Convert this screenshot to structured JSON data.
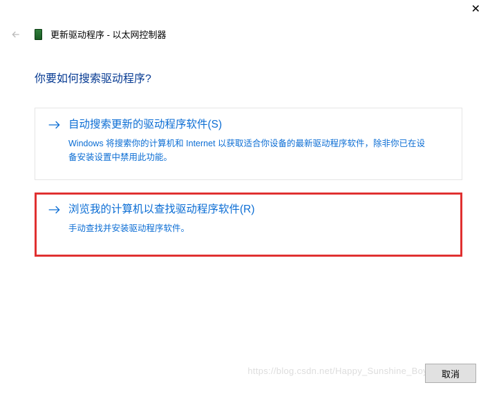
{
  "window": {
    "title": "更新驱动程序 - 以太网控制器"
  },
  "question": "你要如何搜索驱动程序?",
  "options": [
    {
      "title": "自动搜索更新的驱动程序软件(S)",
      "desc": "Windows 将搜索你的计算机和 Internet 以获取适合你设备的最新驱动程序软件，除非你已在设备安装设置中禁用此功能。",
      "highlighted": false
    },
    {
      "title": "浏览我的计算机以查找驱动程序软件(R)",
      "desc": "手动查找并安装驱动程序软件。",
      "highlighted": true
    }
  ],
  "buttons": {
    "cancel": "取消"
  },
  "watermark": "https://blog.csdn.net/Happy_Sunshine_Boy"
}
